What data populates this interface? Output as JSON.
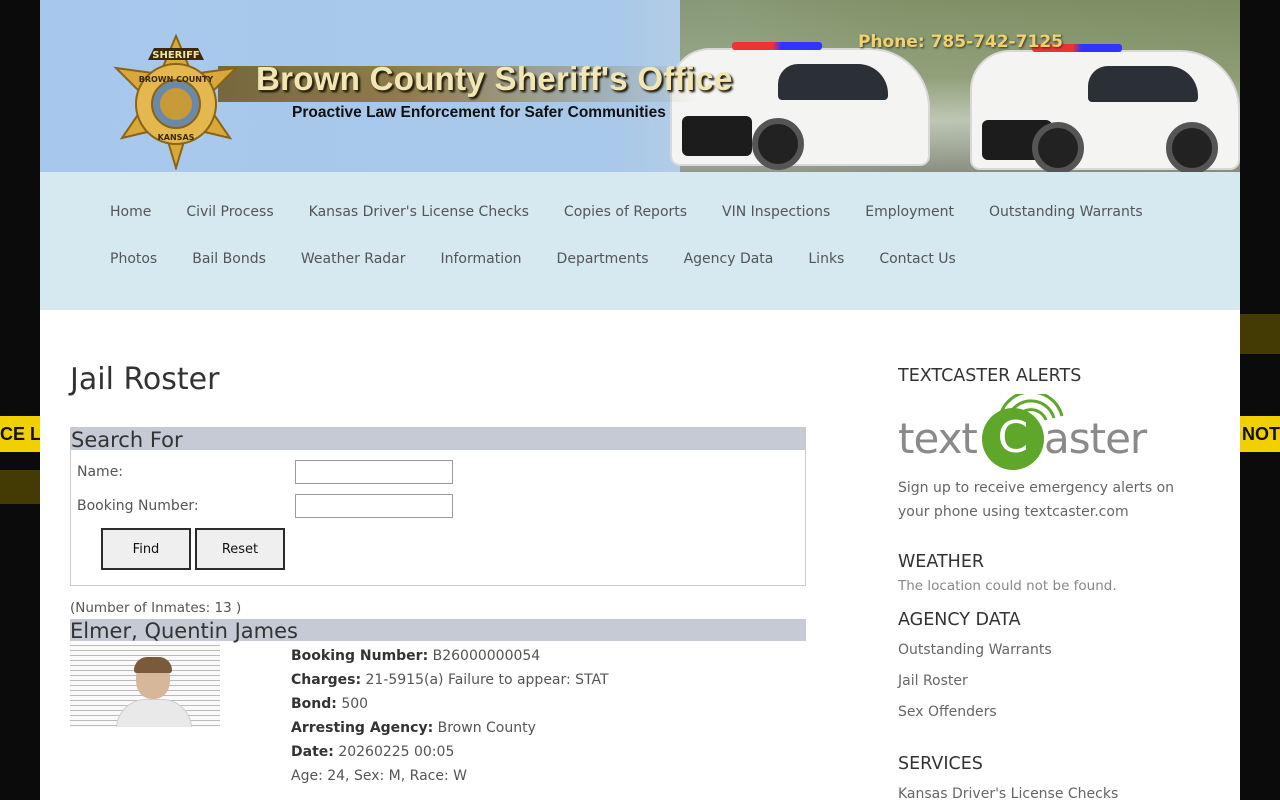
{
  "background_tape": {
    "left_text": "CE L",
    "right_text": "NOT"
  },
  "header": {
    "site_title": "Brown County Sheriff's Office",
    "tagline": "Proactive Law Enforcement for Safer Communities",
    "phone": "Phone: 785-742-7125",
    "badge": {
      "top_text": "SHERIFF",
      "ring_text": "BROWN COUNTY",
      "bottom_text": "KANSAS"
    }
  },
  "nav": {
    "items": [
      "Home",
      "Civil Process",
      "Kansas Driver's License Checks",
      "Copies of Reports",
      "VIN Inspections",
      "Employment",
      "Outstanding Warrants",
      "Photos",
      "Bail Bonds",
      "Weather Radar",
      "Information",
      "Departments",
      "Agency Data",
      "Links",
      "Contact Us"
    ]
  },
  "main": {
    "title": "Jail Roster",
    "search": {
      "heading": "Search For",
      "name_label": "Name:",
      "name_value": "",
      "booking_label": "Booking Number:",
      "booking_value": "",
      "find_label": "Find",
      "reset_label": "Reset"
    },
    "count_text": "(Number of Inmates: 13 )",
    "inmate": {
      "name": "Elmer, Quentin James",
      "booking_label": "Booking Number:",
      "booking_number": "B26000000054",
      "charges_label": "Charges:",
      "charges": "21-5915(a) Failure to appear: STAT",
      "bond_label": "Bond:",
      "bond": "500",
      "agency_label": "Arresting Agency:",
      "agency": "Brown County",
      "date_label": "Date:",
      "date": "20260225 00:05",
      "demographics": "Age: 24, Sex: M, Race: W"
    }
  },
  "sidebar": {
    "textcaster_heading": "TEXTCASTER ALERTS",
    "textcaster_logo": {
      "part1": "text",
      "letter": "C",
      "part2": "aster"
    },
    "textcaster_desc": "Sign up to receive emergency alerts on your phone using textcaster.com",
    "weather_heading": "WEATHER",
    "weather_msg": "The location could not be found.",
    "agency_heading": "AGENCY DATA",
    "agency_links": [
      "Outstanding Warrants",
      "Jail Roster",
      "Sex Offenders"
    ],
    "services_heading": "SERVICES",
    "services_links": [
      "Kansas Driver's License Checks"
    ]
  },
  "colors": {
    "nav_bg": "#d6e8f0",
    "section_head_bg": "#c5cad5",
    "textcaster_green": "#5fa72b",
    "phone_gold": "#f0d36a"
  }
}
